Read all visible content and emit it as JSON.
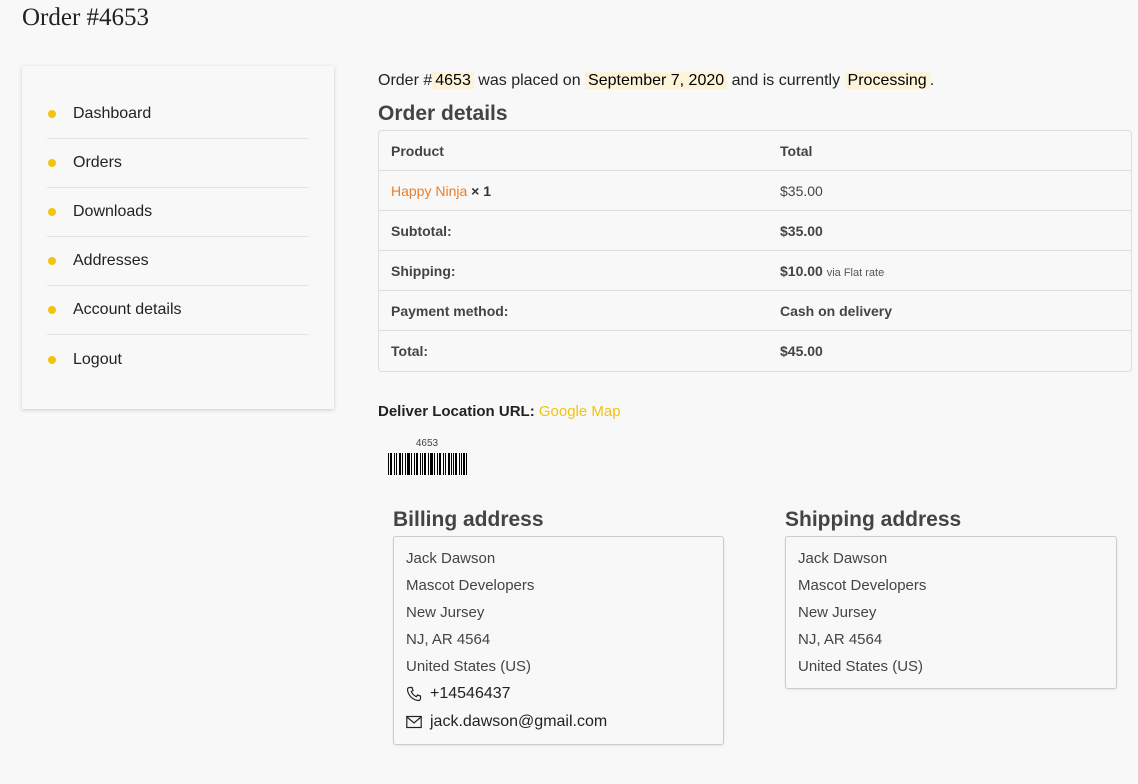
{
  "page": {
    "title": "Order #4653"
  },
  "nav": {
    "items": [
      {
        "label": "Dashboard"
      },
      {
        "label": "Orders"
      },
      {
        "label": "Downloads"
      },
      {
        "label": "Addresses"
      },
      {
        "label": "Account details"
      },
      {
        "label": "Logout"
      }
    ],
    "dot_color": "#f1c40f"
  },
  "status": {
    "prefix": "Order #",
    "order_number": "4653",
    "placed_text": "was placed on",
    "date": "September 7, 2020",
    "current_text": "and is currently",
    "state": "Processing",
    "suffix": "."
  },
  "order_details": {
    "title": "Order details",
    "headers": {
      "product": "Product",
      "total": "Total"
    },
    "item": {
      "name": "Happy Ninja",
      "qty": "× 1",
      "total": "$35.00"
    },
    "subtotal": {
      "label": "Subtotal:",
      "value": "$35.00"
    },
    "shipping": {
      "label": "Shipping:",
      "value": "$10.00",
      "via": "via Flat rate"
    },
    "payment": {
      "label": "Payment method:",
      "value": "Cash on delivery"
    },
    "total": {
      "label": "Total:",
      "value": "$45.00"
    }
  },
  "deliver": {
    "label": "Deliver Location URL:",
    "link": "Google Map",
    "link_color": "#f1c40f"
  },
  "barcode": {
    "number": "4653"
  },
  "billing": {
    "title": "Billing address",
    "lines": [
      "Jack Dawson",
      "Mascot Developers",
      "New Jursey",
      "NJ, AR 4564",
      "United States (US)"
    ],
    "phone": "+14546437",
    "email": "jack.dawson@gmail.com"
  },
  "shipping_address": {
    "title": "Shipping address",
    "lines": [
      "Jack Dawson",
      "Mascot Developers",
      "New Jursey",
      "NJ, AR 4564",
      "United States (US)"
    ]
  },
  "colors": {
    "accent": "#f1c40f",
    "product_link": "#e87f2c",
    "highlight": "#fcf3d9"
  }
}
